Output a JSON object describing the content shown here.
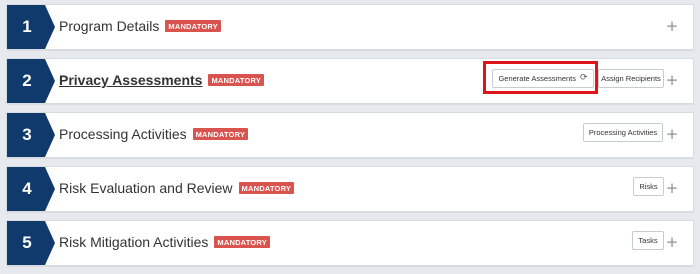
{
  "steps": [
    {
      "number": "1",
      "title": "Program Details",
      "badge": "MANDATORY",
      "buttons": []
    },
    {
      "number": "2",
      "title": "Privacy Assessments",
      "badge": "MANDATORY",
      "buttons": [
        "Generate Assessments",
        "Assign Recipients"
      ]
    },
    {
      "number": "3",
      "title": "Processing Activities",
      "badge": "MANDATORY",
      "buttons": [
        "Processing Activities"
      ]
    },
    {
      "number": "4",
      "title": "Risk Evaluation and Review",
      "badge": "MANDATORY",
      "buttons": [
        "Risks"
      ]
    },
    {
      "number": "5",
      "title": "Risk Mitigation Activities",
      "badge": "MANDATORY",
      "buttons": [
        "Tasks"
      ]
    }
  ],
  "icons": {
    "expand": "plus-icon",
    "refresh": "refresh-icon"
  },
  "colors": {
    "badge_bg": "#103a6b",
    "mandatory_bg": "#d9534f",
    "highlight": "#e0141b"
  }
}
